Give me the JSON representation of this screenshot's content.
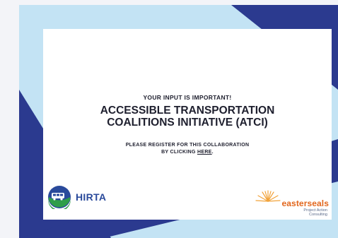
{
  "banner": {
    "kicker": "YOUR INPUT IS IMPORTANT!",
    "title_line1": "ACCESSIBLE TRANSPORTATION",
    "title_line2": "COALITIONS INITIATIVE (ATCI)",
    "cta_line1": "PLEASE REGISTER FOR THIS COLLABORATION",
    "cta_line2_prefix": "BY CLICKING ",
    "cta_link": "HERE",
    "cta_line2_suffix": "."
  },
  "logos": {
    "left_name": "HIRTA",
    "right_name": "easterseals",
    "right_sub_line1": "Project Action",
    "right_sub_line2": "Consulting"
  },
  "colors": {
    "navy": "#2b3a8f",
    "light_blue": "#c3e3f4",
    "card": "#ffffff",
    "hirta_blue": "#2a4a9b",
    "hirta_green": "#2f9e49",
    "easterseals_orange": "#e2661c"
  }
}
